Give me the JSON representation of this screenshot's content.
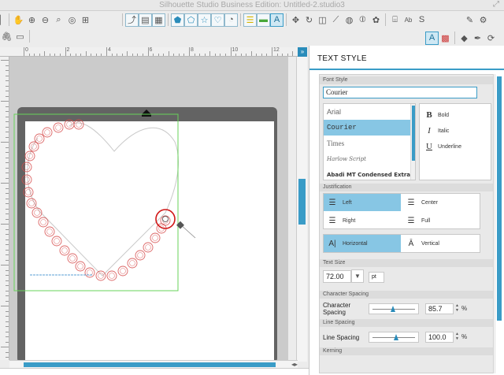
{
  "window": {
    "title": "Silhouette Studio Business Edition: Untitled-2.studio3"
  },
  "toolbar": {
    "row1_icons": [
      "pan-icon",
      "zoom-in-icon",
      "zoom-out-icon",
      "zoom-selection-icon",
      "zoom-drag-icon",
      "fit-to-page-icon"
    ],
    "row1_right_icons": [
      "select-icon",
      "page-setup-icon",
      "grid-icon",
      "pentagon-icon",
      "pentagon-outline-icon",
      "star-icon",
      "heart-icon",
      "registration-icon",
      "replicate-icon",
      "fill-icon",
      "text-style-icon",
      "move-icon",
      "rotate-icon",
      "scale-icon",
      "knife-icon",
      "eraser-icon",
      "trace-icon",
      "offset-icon",
      "library-icon",
      "text-icon",
      "store-icon",
      "send-icon",
      "settings-icon"
    ],
    "text_style_glyph": "A",
    "text_glyph": "Ab"
  },
  "ruler": {
    "labels": [
      "0",
      "2",
      "4",
      "6",
      "8",
      "10",
      "12"
    ]
  },
  "panel": {
    "title": "TEXT STYLE",
    "font_style": {
      "section_label": "Font Style",
      "font_field_value": "Courier",
      "fonts": [
        "Arial",
        "Courier",
        "Times",
        "Harlow Script",
        "Abadi MT Condensed Extra"
      ],
      "selected_font": "Courier",
      "styles": [
        {
          "glyph": "B",
          "label": "Bold"
        },
        {
          "glyph": "I",
          "label": "Italic"
        },
        {
          "glyph": "U",
          "label": "Underline"
        }
      ]
    },
    "justification": {
      "section_label": "Justification",
      "options": [
        "Left",
        "Center",
        "Right",
        "Full"
      ],
      "selected": "Left",
      "direction": [
        "Horizontal",
        "Vertical"
      ],
      "selected_direction": "Horizontal"
    },
    "text_size": {
      "section_label": "Text Size",
      "value": "72.00",
      "unit": "pt"
    },
    "character_spacing": {
      "section_label": "Character Spacing",
      "label": "Character Spacing",
      "value": "85.7",
      "unit": "%",
      "level": 0.43
    },
    "line_spacing": {
      "section_label": "Line Spacing",
      "label": "Line Spacing",
      "value": "100.0",
      "unit": "%",
      "level": 0.5
    },
    "kerning": {
      "section_label": "Kerning"
    }
  },
  "colors": {
    "accent": "#3a9cc7",
    "selection_green": "#67d35a",
    "design_red": "#d64a4a",
    "mat": "#636363"
  }
}
